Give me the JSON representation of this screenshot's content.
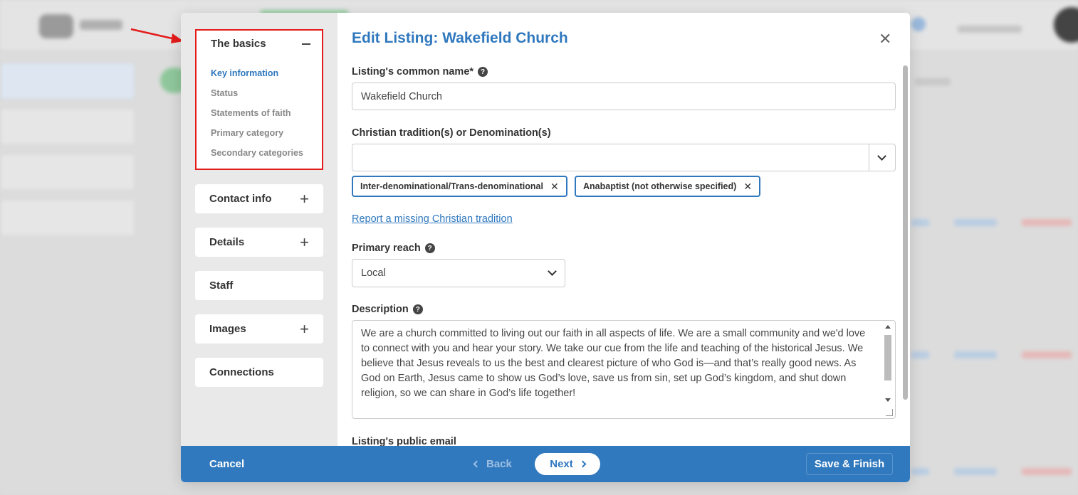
{
  "modal": {
    "title": "Edit Listing: Wakefield Church",
    "close_icon": "close-icon"
  },
  "sidebar": {
    "basics": {
      "label": "The basics",
      "items": [
        "Key information",
        "Status",
        "Statements of faith",
        "Primary category",
        "Secondary categories"
      ],
      "active_index": 0
    },
    "sections": [
      {
        "label": "Contact info",
        "expandable": true
      },
      {
        "label": "Details",
        "expandable": true
      },
      {
        "label": "Staff",
        "expandable": false
      },
      {
        "label": "Images",
        "expandable": true
      },
      {
        "label": "Connections",
        "expandable": false
      }
    ]
  },
  "form": {
    "common_name": {
      "label": "Listing's common name*",
      "value": "Wakefield Church"
    },
    "tradition": {
      "label": "Christian tradition(s) or Denomination(s)",
      "tags": [
        "Inter-denominational/Trans-denominational",
        "Anabaptist (not otherwise specified)"
      ],
      "report_link": "Report a missing Christian tradition"
    },
    "primary_reach": {
      "label": "Primary reach",
      "value": "Local"
    },
    "description": {
      "label": "Description",
      "value": "We are a church committed to living out our faith in all aspects of life. We are a small community and we'd love to connect with you and hear your story.  We take our cue from the life and teaching of the historical Jesus. We believe that Jesus reveals to us the best and clearest picture of who God is—and that’s really good news. As God on Earth, Jesus came to show us God’s love, save us from sin, set up God’s kingdom, and shut down religion, so we can share in God’s life together!"
    },
    "public_email": {
      "label": "Listing's public email"
    }
  },
  "footer": {
    "cancel": "Cancel",
    "back": "Back",
    "next": "Next",
    "save": "Save & Finish"
  },
  "colors": {
    "accent": "#2f78be",
    "footer": "#3179be",
    "highlight": "#e41b1b"
  }
}
